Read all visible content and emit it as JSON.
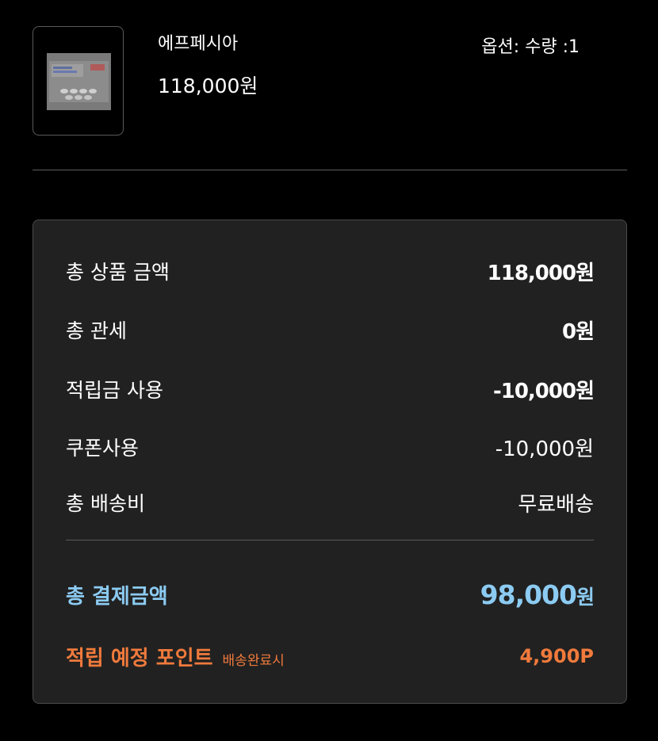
{
  "product": {
    "image_icon": "medicine-box-image",
    "name": "에프페시아",
    "price": "118,000원",
    "option": "옵션: 수량 :1"
  },
  "summary": {
    "subtotal_label": "총 상품 금액",
    "subtotal_value": "118,000원",
    "customs_label": "총 관세",
    "customs_value": "0원",
    "points_use_label": "적립금 사용",
    "points_use_value": "-10,000원",
    "coupon_label": "쿠폰사용",
    "coupon_value": "-10,000원",
    "shipping_label": "총 배송비",
    "shipping_value": "무료배송",
    "total_label": "총 결제금액",
    "total_amount": "98,000",
    "total_unit": "원",
    "reward_label": "적립 예정 포인트",
    "reward_note": "배송완료시",
    "reward_value": "4,900P"
  },
  "colors": {
    "background": "#000000",
    "card": "#212121",
    "total_accent": "#8ccbf2",
    "reward_accent": "#f07a3c"
  }
}
